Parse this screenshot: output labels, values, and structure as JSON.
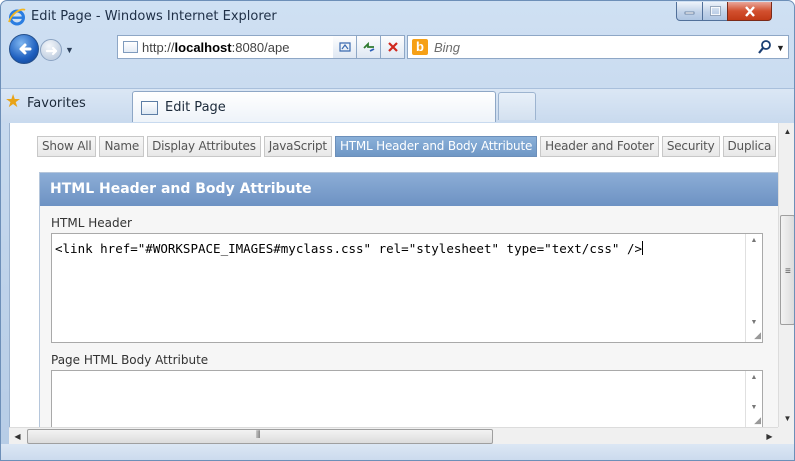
{
  "window": {
    "title": "Edit Page - Windows Internet Explorer"
  },
  "address_bar": {
    "url_host": "http://",
    "url_bold": "localhost",
    "url_rest": ":8080/ape"
  },
  "search": {
    "placeholder": "Bing"
  },
  "favorites": {
    "label": "Favorites"
  },
  "tab": {
    "label": "Edit Page"
  },
  "page_tabs": [
    "Show All",
    "Name",
    "Display Attributes",
    "JavaScript",
    "HTML Header and Body Attribute",
    "Header and Footer",
    "Security",
    "Duplica"
  ],
  "active_tab_index": 4,
  "region": {
    "title": "HTML Header and Body Attribute",
    "html_header_label": "HTML Header",
    "html_header_value": "<link href=\"#WORKSPACE_IMAGES#myclass.css\" rel=\"stylesheet\" type=\"text/css\" />",
    "body_attr_label": "Page HTML Body Attribute",
    "body_attr_value": ""
  },
  "colors": {
    "region_header": "#7a9ccb",
    "active_tab": "#7ea5d1",
    "close_button": "#c9461f"
  }
}
